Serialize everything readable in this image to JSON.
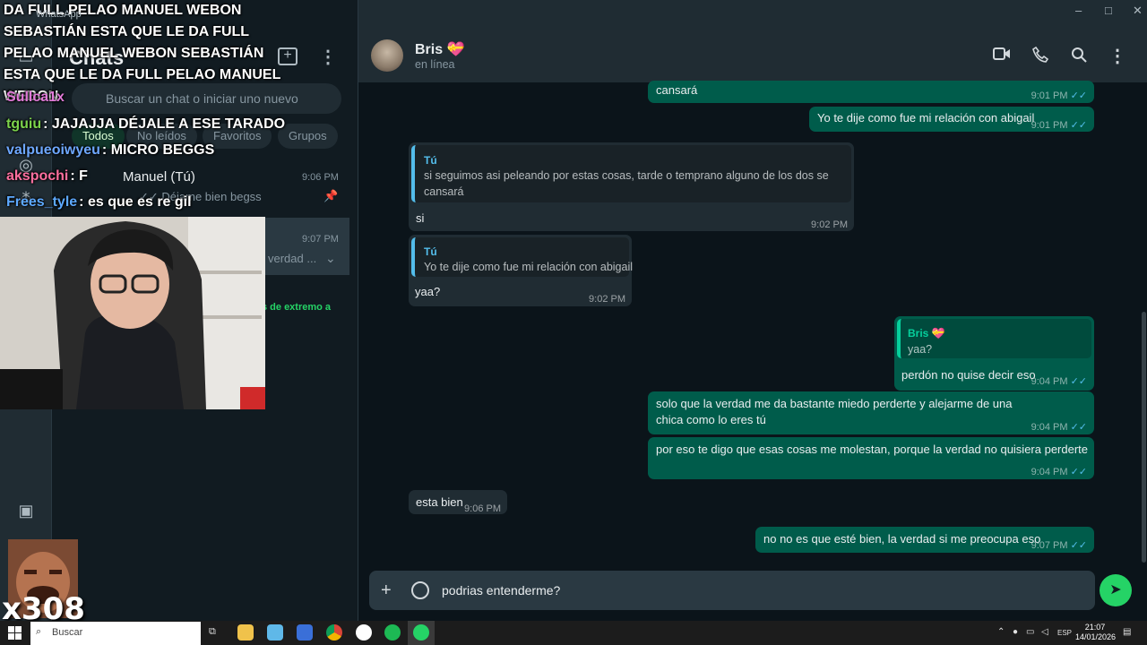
{
  "window": {
    "app_label": "WhatsApp",
    "controls": [
      "–",
      "□",
      "✕"
    ]
  },
  "sidebar": {
    "title": "Chats",
    "search_placeholder": "Buscar un chat o iniciar uno nuevo",
    "filters": [
      "Todos",
      "No leídos",
      "Favoritos",
      "Grupos"
    ],
    "chats": [
      {
        "name": "Manuel (Tú)",
        "time": "9:06 PM",
        "preview": "✓✓ Déjame bien begss"
      },
      {
        "time": "9:07 PM",
        "preview": "verdad ..."
      },
      {
        "preview": "s de extremo a"
      }
    ]
  },
  "stream_overlay": {
    "alert": "DA FULL PELAO MANUEL WEBON SEBASTIÁN ESTA QUE LE DA FULL PELAO MANUEL WEBON SEBASTIÁN ESTA QUE LE DA FULL PELAO MANUEL WEBON",
    "chat": [
      {
        "user": "Sullca1x",
        "color": "#e07ad8",
        "message": ""
      },
      {
        "user": "tguiu",
        "color": "#7cd34b",
        "message": ": JAJAJJA DÉJALE A ESE TARADO"
      },
      {
        "user": "valpueoiwyeu",
        "color": "#6ea8ff",
        "message": ": MICRO BEGGS"
      },
      {
        "user": "akspochi",
        "color": "#ff6f9f",
        "message": ": F"
      },
      {
        "user": "Frees_tyle",
        "color": "#5da9ff",
        "message": ": es que es re gil"
      }
    ],
    "emote_count": "x308"
  },
  "header": {
    "contact_name": "Bris 💝",
    "contact_status": "en línea",
    "icons": [
      "video-call-icon",
      "phone-icon",
      "search-icon",
      "menu-icon"
    ]
  },
  "messages": [
    {
      "dir": "out",
      "text": "cansará",
      "time": "9:01 PM"
    },
    {
      "dir": "out",
      "text": "Yo te dije como fue mi relación con abigail",
      "time": "9:01 PM"
    },
    {
      "dir": "in",
      "quote_author": "Tú",
      "quote_text": "si seguimos asi peleando por estas cosas, tarde o temprano alguno de los dos se cansará",
      "text": "si",
      "time": "9:02 PM"
    },
    {
      "dir": "in",
      "quote_author": "Tú",
      "quote_text": "Yo te dije como fue mi relación con abigail",
      "text": "yaa?",
      "time": "9:02 PM"
    },
    {
      "dir": "out",
      "quote_author": "Bris 💝",
      "quote_text": "yaa?",
      "text": "perdón no quise decir eso",
      "time": "9:04 PM"
    },
    {
      "dir": "out",
      "text": "solo que la verdad me da bastante miedo perderte y alejarme de una chica como lo eres tú",
      "time": "9:04 PM"
    },
    {
      "dir": "out",
      "text": "por eso te digo que esas cosas me molestan, porque la verdad no quisiera perderte",
      "time": "9:04 PM"
    },
    {
      "dir": "in",
      "text": "esta bien",
      "time": "9:06 PM"
    },
    {
      "dir": "out",
      "text": "no no es que esté bien, la verdad si me preocupa eso",
      "time": "9:07 PM"
    }
  ],
  "composer": {
    "draft": "podrias entenderme?"
  },
  "taskbar": {
    "search_label": "Buscar",
    "tray_lang": "ESP",
    "time": "21:07",
    "date": "14/01/2026"
  }
}
